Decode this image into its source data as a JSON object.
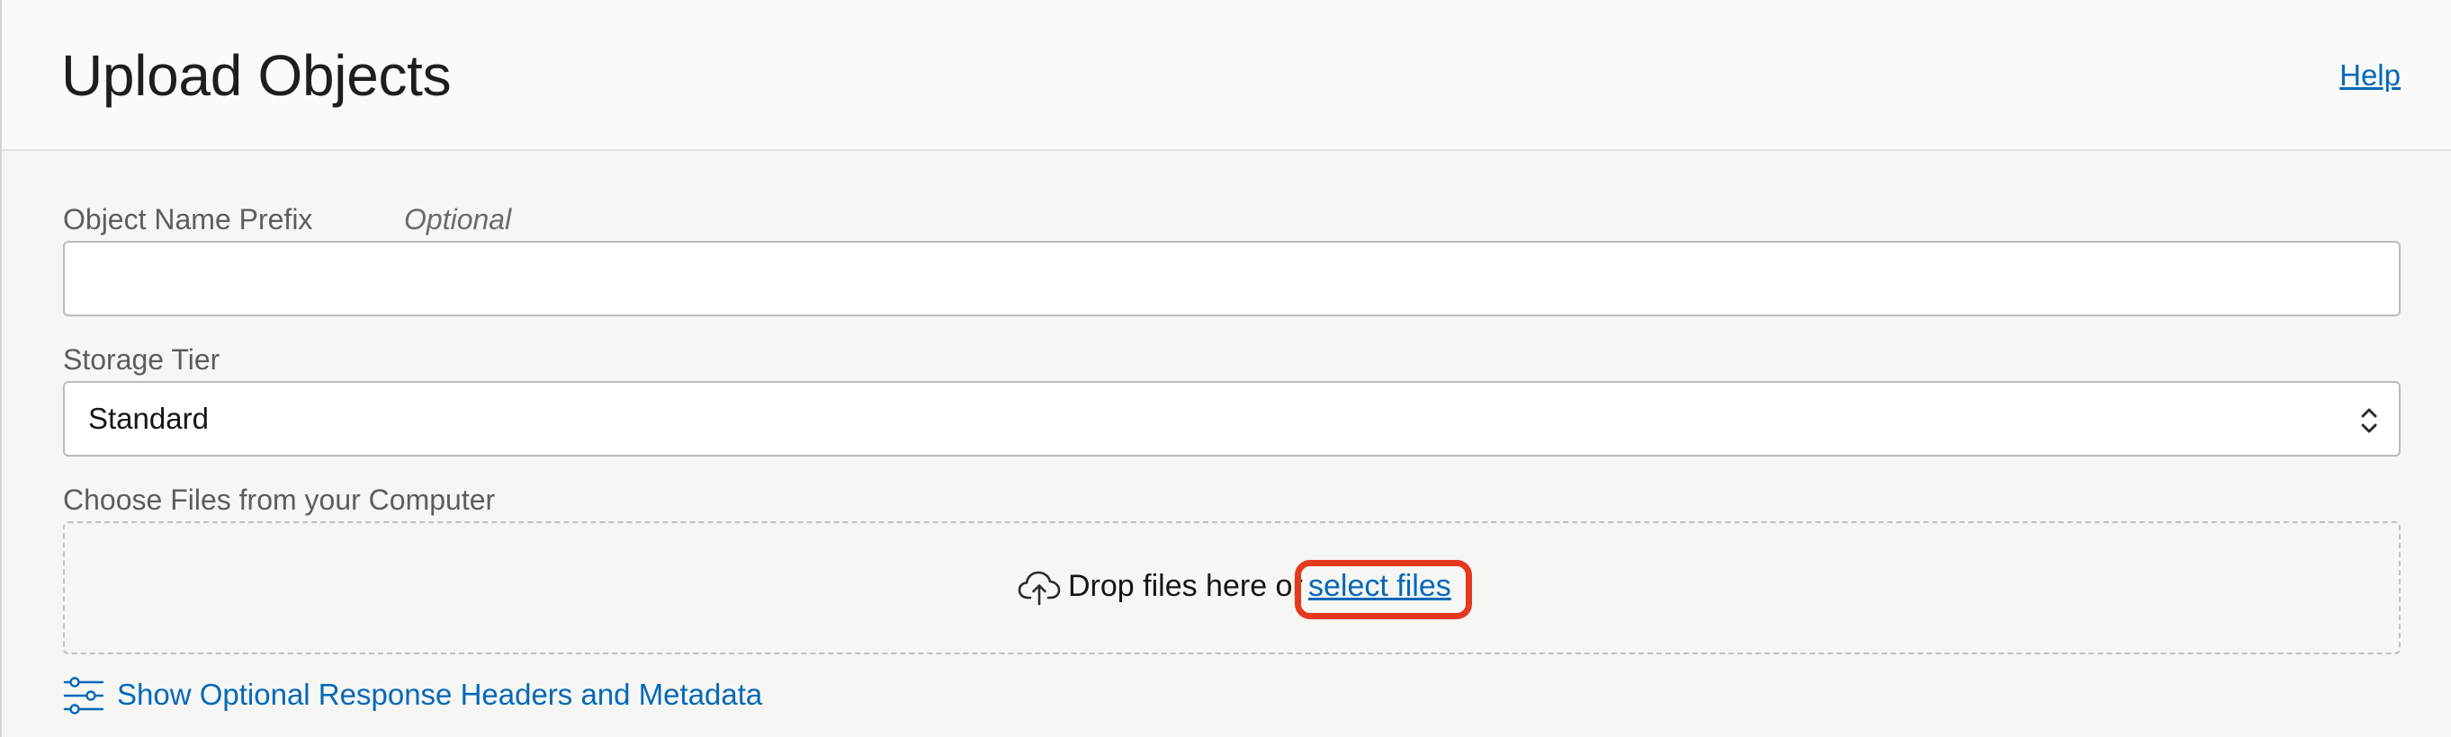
{
  "header": {
    "title": "Upload Objects",
    "help_label": "Help"
  },
  "form": {
    "prefix": {
      "label": "Object Name Prefix",
      "hint": "Optional",
      "value": "",
      "placeholder": ""
    },
    "storage_tier": {
      "label": "Storage Tier",
      "selected": "Standard"
    },
    "files": {
      "label": "Choose Files from your Computer",
      "drop_text": "Drop files here or",
      "select_link": "select files"
    },
    "metadata_link": "Show Optional Response Headers and Metadata"
  },
  "icons": {
    "upload": "cloud-upload-icon",
    "caret": "select-caret-icon",
    "sliders": "sliders-icon"
  },
  "colors": {
    "link": "#0468b8",
    "highlight": "#e5391f"
  }
}
